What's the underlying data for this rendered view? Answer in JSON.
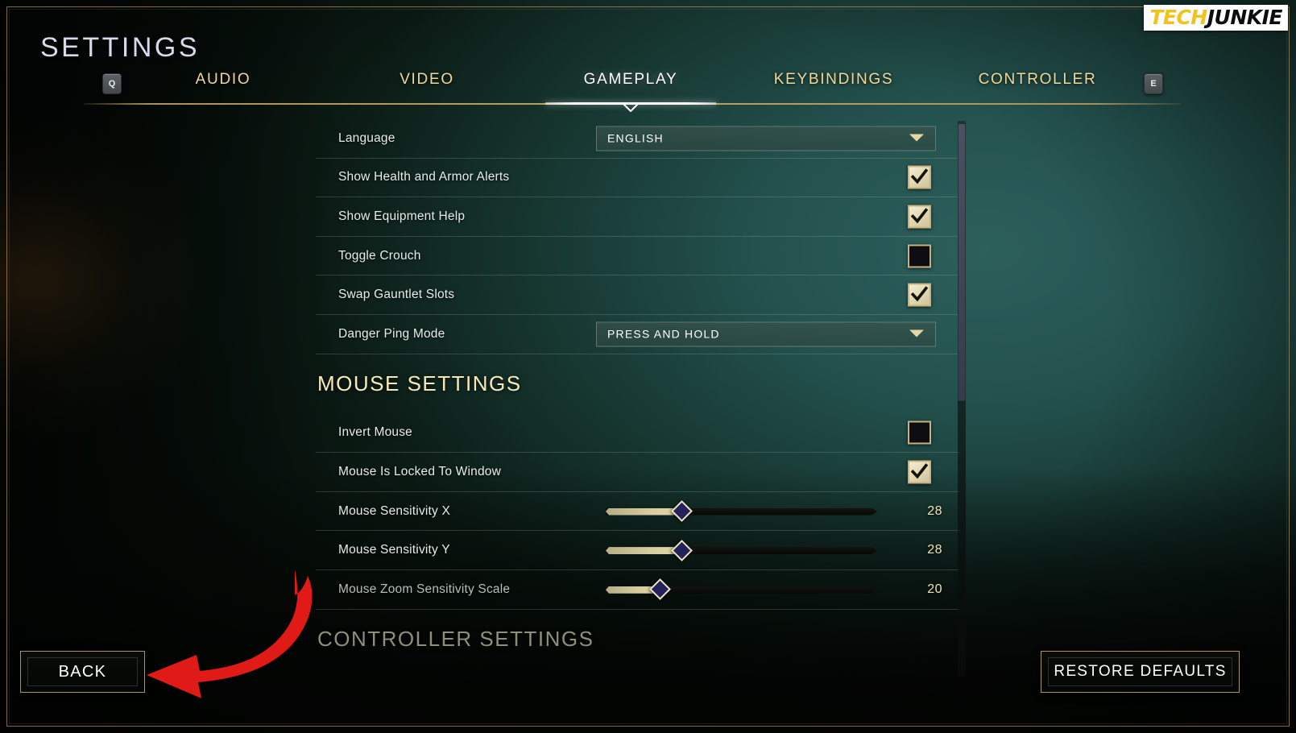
{
  "header": {
    "title": "SETTINGS",
    "left_key_hint": "Q",
    "right_key_hint": "E",
    "tabs": [
      {
        "label": "AUDIO",
        "active": false
      },
      {
        "label": "VIDEO",
        "active": false
      },
      {
        "label": "GAMEPLAY",
        "active": true
      },
      {
        "label": "KEYBINDINGS",
        "active": false
      },
      {
        "label": "CONTROLLER",
        "active": false
      }
    ]
  },
  "logo": {
    "part1": "TECH",
    "part2": "JUNKIE"
  },
  "settings": {
    "gameplay_rows": [
      {
        "label": "Language",
        "type": "dropdown",
        "value": "ENGLISH"
      },
      {
        "label": "Show Health and Armor Alerts",
        "type": "checkbox",
        "checked": true
      },
      {
        "label": "Show Equipment Help",
        "type": "checkbox",
        "checked": true
      },
      {
        "label": "Toggle Crouch",
        "type": "checkbox",
        "checked": false
      },
      {
        "label": "Swap Gauntlet Slots",
        "type": "checkbox",
        "checked": true
      },
      {
        "label": "Danger Ping Mode",
        "type": "dropdown",
        "value": "PRESS AND HOLD"
      }
    ],
    "mouse_section_title": "MOUSE SETTINGS",
    "mouse_rows": [
      {
        "label": "Invert Mouse",
        "type": "checkbox",
        "checked": false
      },
      {
        "label": "Mouse Is Locked To Window",
        "type": "checkbox",
        "checked": true
      },
      {
        "label": "Mouse Sensitivity X",
        "type": "slider",
        "value": "28",
        "percent": 28
      },
      {
        "label": "Mouse Sensitivity Y",
        "type": "slider",
        "value": "28",
        "percent": 28
      },
      {
        "label": "Mouse Zoom Sensitivity Scale",
        "type": "slider",
        "value": "20",
        "percent": 20
      }
    ],
    "controller_section_title": "CONTROLLER SETTINGS"
  },
  "footer": {
    "back_label": "BACK",
    "restore_label": "RESTORE DEFAULTS"
  },
  "colors": {
    "accent_gold": "#f1d898",
    "active_tab": "#ffffff",
    "annotation_red": "#e01b17",
    "slider_fill": "#d6cc9e",
    "checkbox_fill": "#e8dfbd",
    "panel_background": "#23514e"
  }
}
